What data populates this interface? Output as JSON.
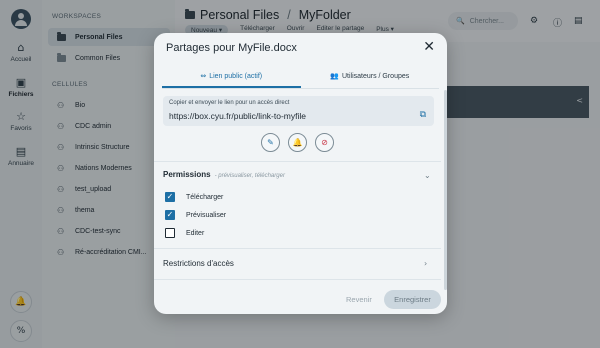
{
  "rail": {
    "items": [
      {
        "label": "Accueil",
        "icon": "home-icon",
        "glyph": "⌂"
      },
      {
        "label": "Fichiers",
        "icon": "files-icon",
        "glyph": "▣"
      },
      {
        "label": "Favoris",
        "icon": "star-icon",
        "glyph": "☆"
      },
      {
        "label": "Annuaire",
        "icon": "directory-icon",
        "glyph": "▤"
      }
    ],
    "bottom": [
      {
        "icon": "bell-icon",
        "glyph": "🔔"
      },
      {
        "icon": "percent-icon",
        "glyph": "%"
      }
    ]
  },
  "sidebar": {
    "workspaces_title": "WORKSPACES",
    "workspaces": [
      {
        "label": "Personal Files"
      },
      {
        "label": "Common Files"
      }
    ],
    "cells_title": "CELLULES",
    "cells": [
      {
        "label": "Bio"
      },
      {
        "label": "CDC admin"
      },
      {
        "label": "Intrinsic Structure"
      },
      {
        "label": "Nations Modernes"
      },
      {
        "label": "test_upload"
      },
      {
        "label": "thema"
      },
      {
        "label": "CDC-test-sync"
      },
      {
        "label": "Ré-accréditation CMI..."
      }
    ]
  },
  "header": {
    "crumb_root": "Personal Files",
    "crumb_sep": "/",
    "crumb_current": "MyFolder",
    "toolbar": [
      "Nouveau ▾",
      "Télécharger",
      "Ouvrir",
      "Editer le partage",
      "Plus ▾"
    ],
    "search_placeholder": "Chercher..."
  },
  "modal": {
    "title": "Partages pour MyFile.docx",
    "close_glyph": "✕",
    "tabs": [
      {
        "label": "Lien public (actif)",
        "glyph": "⇔",
        "active": true
      },
      {
        "label": "Utilisateurs / Groupes",
        "glyph": "👥",
        "active": false
      }
    ],
    "link_label": "Copier et envoyer le lien pour un accès direct",
    "link_url": "https://box.cyu.fr/public/link-to-myfile",
    "permissions_title": "Permissions",
    "permissions_subtitle": "- prévisualiser, télécharger",
    "permissions": [
      {
        "label": "Télécharger",
        "checked": true
      },
      {
        "label": "Prévisualiser",
        "checked": true
      },
      {
        "label": "Editer",
        "checked": false
      }
    ],
    "restrictions_title": "Restrictions d'accès",
    "revert_label": "Revenir",
    "save_label": "Enregistrer"
  },
  "colors": {
    "accent": "#1d6fa5",
    "danger": "#c9394a",
    "dark_band": "#4b5b66"
  }
}
